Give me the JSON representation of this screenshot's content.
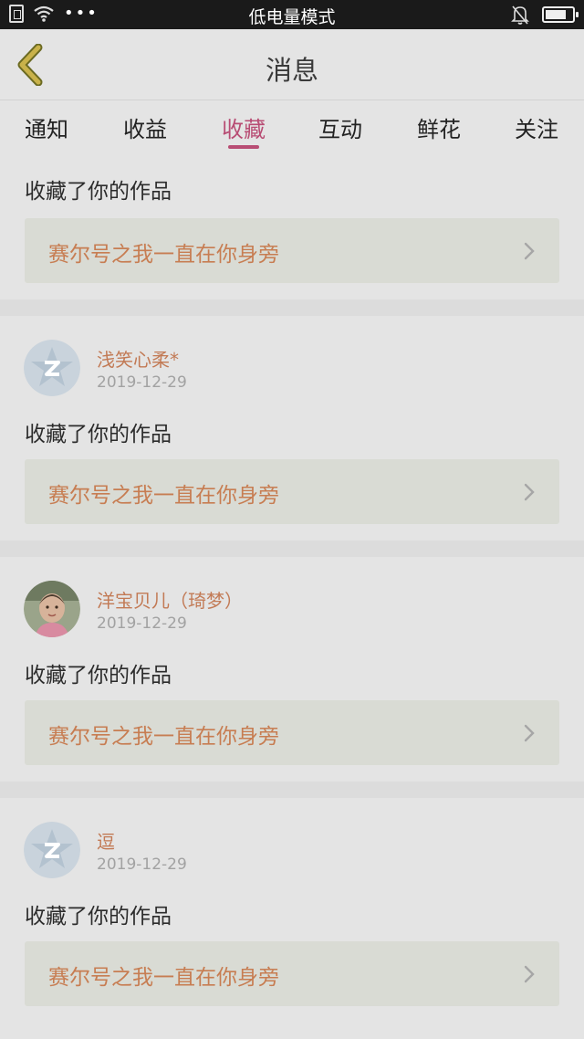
{
  "status_bar": {
    "title": "低电量模式",
    "dots": "•••"
  },
  "header": {
    "title": "消息"
  },
  "tabs": [
    {
      "label": "通知",
      "active": false
    },
    {
      "label": "收益",
      "active": false
    },
    {
      "label": "收藏",
      "active": true
    },
    {
      "label": "互动",
      "active": false
    },
    {
      "label": "鲜花",
      "active": false
    },
    {
      "label": "关注",
      "active": false
    }
  ],
  "messages": [
    {
      "action": "收藏了你的作品",
      "work_title": "赛尔号之我一直在你身旁"
    },
    {
      "user": "浅笑心柔*",
      "date": "2019-12-29",
      "avatar": "default-qq-avatar-icon",
      "action": "收藏了你的作品",
      "work_title": "赛尔号之我一直在你身旁"
    },
    {
      "user": "洋宝贝儿（琦梦）",
      "date": "2019-12-29",
      "avatar": "baby-photo-avatar",
      "action": "收藏了你的作品",
      "work_title": "赛尔号之我一直在你身旁"
    },
    {
      "user": "逗",
      "date": "2019-12-29",
      "avatar": "default-qq-avatar-icon",
      "action": "收藏了你的作品",
      "work_title": "赛尔号之我一直在你身旁"
    }
  ],
  "colors": {
    "accent": "#b84d74",
    "work_title": "#c77d52",
    "background": "#e4e4e4"
  }
}
